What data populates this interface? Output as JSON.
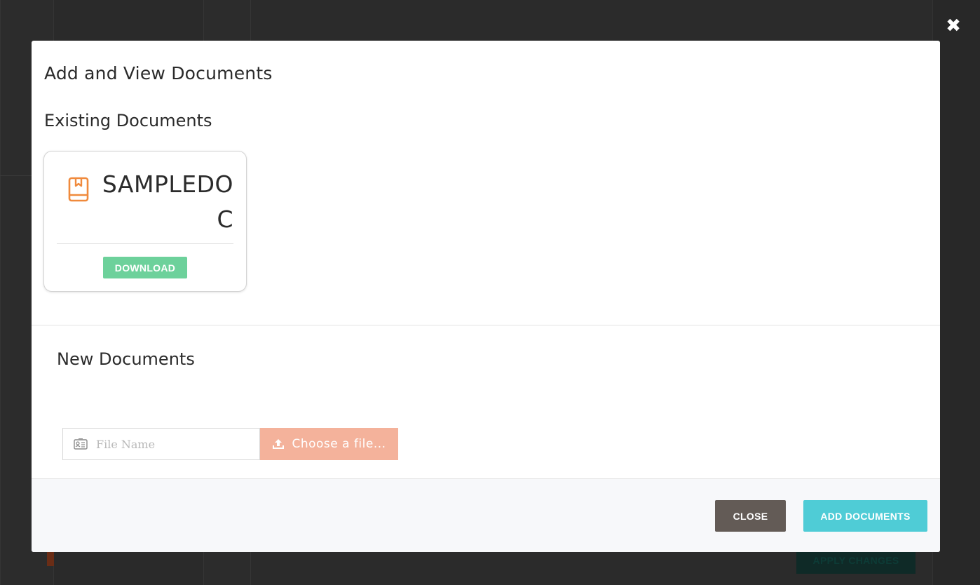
{
  "background": {
    "apply_label": "APPLY CHANGES"
  },
  "overlay": {
    "close_icon": "close-x-icon"
  },
  "modal": {
    "title": "Add and View Documents",
    "existing": {
      "heading": "Existing Documents",
      "documents": [
        {
          "name": "SAMPLEDOC",
          "icon": "book-bookmark-icon",
          "download_label": "DOWNLOAD"
        }
      ]
    },
    "new": {
      "heading": "New Documents",
      "file_name_placeholder": "File Name",
      "file_name_value": "",
      "choose_file_label": "Choose a file..."
    },
    "footer": {
      "close_label": "CLOSE",
      "add_label": "ADD DOCUMENTS"
    }
  },
  "colors": {
    "accent_orange": "#f08a3c",
    "download_green": "#6dd19b",
    "choose_file_salmon": "#f4b29b",
    "close_dark": "#635b56",
    "add_teal": "#4fccd6"
  }
}
